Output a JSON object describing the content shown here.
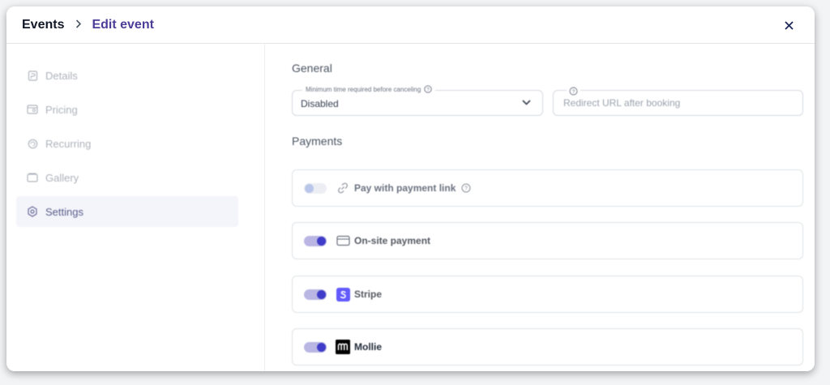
{
  "breadcrumb": {
    "root": "Events",
    "current": "Edit event"
  },
  "sidebar": {
    "items": [
      {
        "label": "Details",
        "icon": "document-icon"
      },
      {
        "label": "Pricing",
        "icon": "ticket-icon"
      },
      {
        "label": "Recurring",
        "icon": "repeat-icon"
      },
      {
        "label": "Gallery",
        "icon": "gallery-icon"
      },
      {
        "label": "Settings",
        "icon": "gear-icon",
        "active": true
      }
    ]
  },
  "general": {
    "title": "General",
    "cancel_field": {
      "label": "Minimum time required before canceling",
      "value": "Disabled"
    },
    "redirect_field": {
      "placeholder": "Redirect URL after booking"
    }
  },
  "payments": {
    "title": "Payments",
    "methods": [
      {
        "label": "Pay with payment link",
        "enabled": false
      },
      {
        "label": "On-site payment",
        "enabled": true
      },
      {
        "label": "Stripe",
        "enabled": true
      },
      {
        "label": "Mollie",
        "enabled": true
      }
    ]
  },
  "colors": {
    "accent": "#3f3cc9",
    "breadcrumb_current": "#4c3d99",
    "stripe_brand": "#635bff",
    "mollie_brand": "#000000"
  }
}
